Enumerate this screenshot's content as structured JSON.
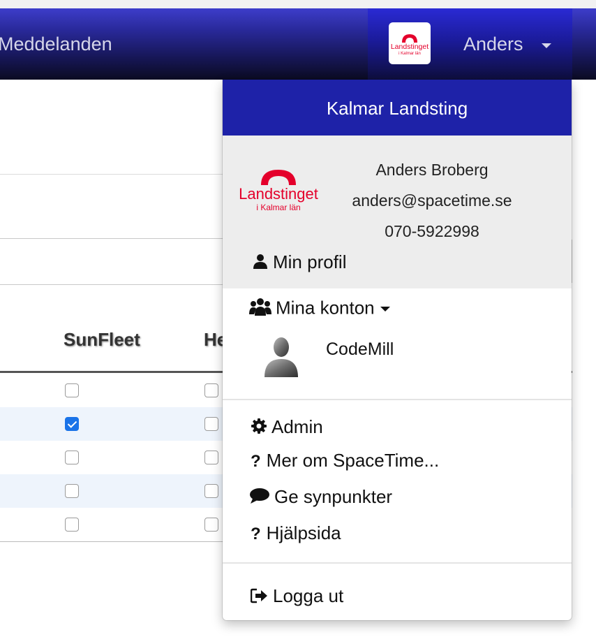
{
  "navbar": {
    "messages_label": "Meddelanden",
    "user_label": "Anders",
    "logo_icon": "landstinget-logo"
  },
  "table": {
    "columns": [
      "SunFleet",
      "He"
    ],
    "rows": [
      {
        "sunfleet": false,
        "he": false
      },
      {
        "sunfleet": true,
        "he": false
      },
      {
        "sunfleet": false,
        "he": false
      },
      {
        "sunfleet": false,
        "he": false
      },
      {
        "sunfleet": false,
        "he": false
      }
    ]
  },
  "dropdown": {
    "org_name": "Kalmar Landsting",
    "logo": {
      "main": "Landstinget",
      "sub": "i Kalmar län"
    },
    "user_name": "Anders Broberg",
    "email": "anders@spacetime.se",
    "phone": "070-5922998",
    "profile_label": "Min profil",
    "accounts_label": "Mina konton",
    "accounts": [
      {
        "name": "CodeMill",
        "icon": "avatar-silhouette"
      }
    ],
    "menu": [
      {
        "label": "Admin",
        "icon": "gear-icon"
      },
      {
        "label": "Mer om SpaceTime...",
        "icon": "question-icon"
      },
      {
        "label": "Ge synpunkter",
        "icon": "comment-icon"
      },
      {
        "label": "Hjälpsida",
        "icon": "question-icon"
      }
    ],
    "logout_label": "Logga ut"
  },
  "colors": {
    "header_blue": "#1e22a8",
    "logo_red": "#e4002b",
    "check_blue": "#1a73e8"
  }
}
